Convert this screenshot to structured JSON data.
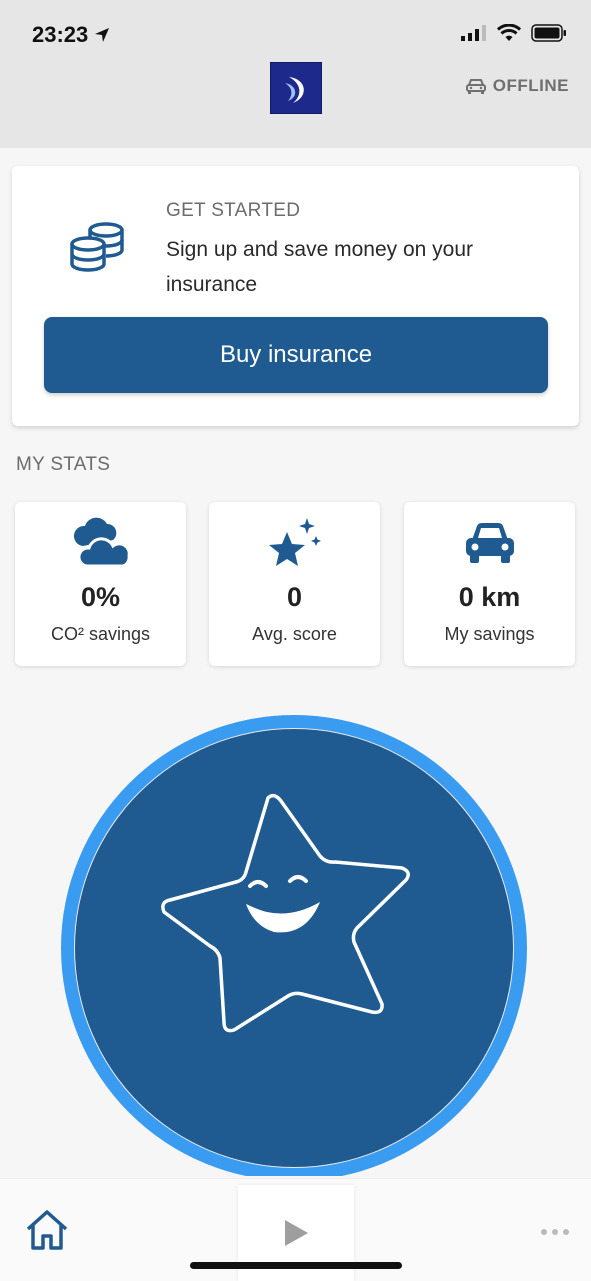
{
  "status_bar": {
    "time": "23:23"
  },
  "header": {
    "offline_label": "OFFLINE"
  },
  "get_started": {
    "title": "GET STARTED",
    "text": "Sign up and save money on your insurance",
    "button_label": "Buy insurance"
  },
  "stats": {
    "heading": "MY STATS",
    "items": [
      {
        "icon": "cloud-icon",
        "value": "0%",
        "label": "CO² savings"
      },
      {
        "icon": "sparkle-star-icon",
        "value": "0",
        "label": "Avg. score"
      },
      {
        "icon": "car-icon",
        "value": "0 km",
        "label": "My savings"
      }
    ]
  },
  "colors": {
    "primary": "#1f5a90",
    "ring": "#3a9cf0",
    "header_bg": "#e6e6e6"
  },
  "tabbar": {
    "items": [
      {
        "icon": "home-icon"
      },
      {
        "icon": "play-icon"
      },
      {
        "icon": "more-icon"
      }
    ]
  }
}
